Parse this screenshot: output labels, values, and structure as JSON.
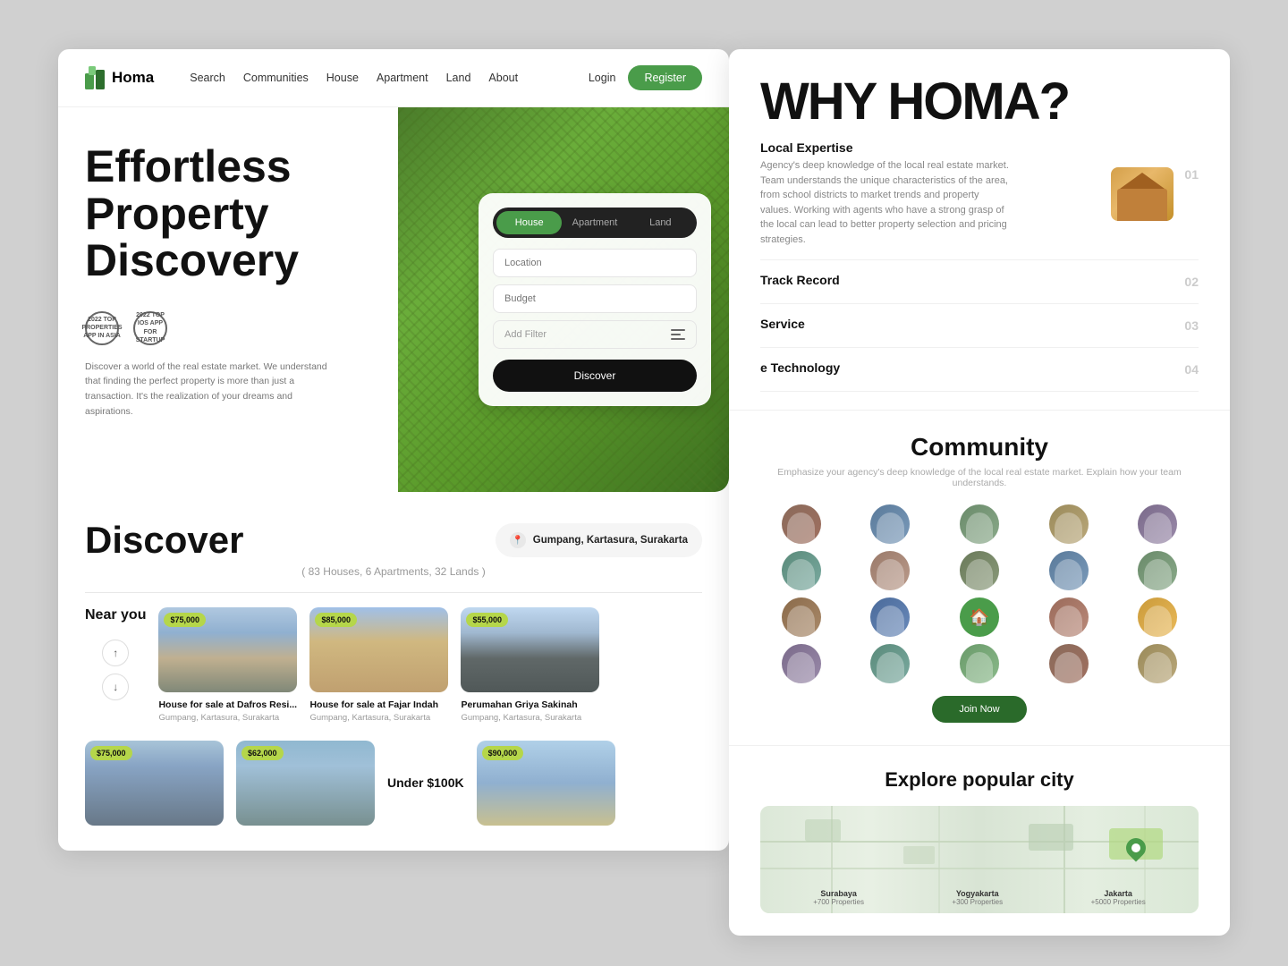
{
  "brand": {
    "name": "Homa",
    "logo_icon": "🏠"
  },
  "navbar": {
    "links": [
      "Search",
      "Communities",
      "House",
      "Apartment",
      "Land",
      "About"
    ],
    "login": "Login",
    "register": "Register"
  },
  "hero": {
    "title": "Effortless Property Discovery",
    "description": "Discover a world of the real estate market. We understand that finding the perfect property is more than just a transaction. It's the realization of your dreams and aspirations."
  },
  "awards": [
    {
      "line1": "2022 TOP",
      "line2": "PROPERTIES",
      "line3": "APP IN ASIA"
    },
    {
      "line1": "2022 TOP OF",
      "line2": "IOS APP FOR",
      "line3": "STARTUP"
    }
  ],
  "search": {
    "tabs": [
      "House",
      "Apartment",
      "Land"
    ],
    "active_tab": "House",
    "location_placeholder": "Location",
    "budget_placeholder": "Budget",
    "filter_label": "Add Filter",
    "discover_btn": "Discover"
  },
  "discover": {
    "title": "Discover",
    "count": "( 83 Houses, 6 Apartments, 32 Lands )",
    "location": "Gumpang, Kartasura, Surakarta"
  },
  "properties_near_you": {
    "section_label": "Near you",
    "items": [
      {
        "price": "$75,000",
        "name": "House for sale at Dafros Resi...",
        "location": "Gumpang, Kartasura, Surakarta",
        "img_class": "house-img-1"
      },
      {
        "price": "$85,000",
        "name": "House for sale at Fajar Indah",
        "location": "Gumpang, Kartasura, Surakarta",
        "img_class": "house-img-2"
      },
      {
        "price": "$55,000",
        "name": "Perumahan Griya Sakinah",
        "location": "Gumpang, Kartasura, Surakarta",
        "img_class": "house-img-3"
      }
    ]
  },
  "properties_row2": [
    {
      "price": "$75,000",
      "name": "...",
      "img_class": "house-img-4"
    },
    {
      "price": "$62,000",
      "name": "...",
      "img_class": "house-img-5"
    },
    {
      "price": "$90,000",
      "name": "...",
      "img_class": "house-img-6"
    }
  ],
  "under_100k": "Under $100K",
  "why_homa": {
    "title": "WHY HOMA?",
    "items": [
      {
        "number": "01",
        "name": "Local Expertise",
        "description": "Agency's deep knowledge of the local real estate market. Team understands the unique characteristics of the area, from school districts to market trends and property values. Working with agents who have a strong grasp of the local can lead to better property selection and pricing strategies.",
        "has_thumb": true
      },
      {
        "number": "02",
        "name": "Track Record",
        "description": "",
        "has_thumb": false
      },
      {
        "number": "03",
        "name": "Service",
        "description": "",
        "has_thumb": false
      },
      {
        "number": "04",
        "name": "e Technology",
        "description": "",
        "has_thumb": false
      }
    ]
  },
  "community": {
    "title": "Community",
    "subtitle": "Emphasize your agency's deep knowledge of the local real estate market. Explain how your team understands.",
    "join_btn": "Join Now"
  },
  "explore": {
    "title": "Explore popular city",
    "cities": [
      {
        "name": "Surabaya",
        "count": "+700 Properties"
      },
      {
        "name": "Yogyakarta",
        "count": "+300 Properties"
      },
      {
        "name": "Jakarta",
        "count": "+5000 Properties"
      }
    ]
  }
}
